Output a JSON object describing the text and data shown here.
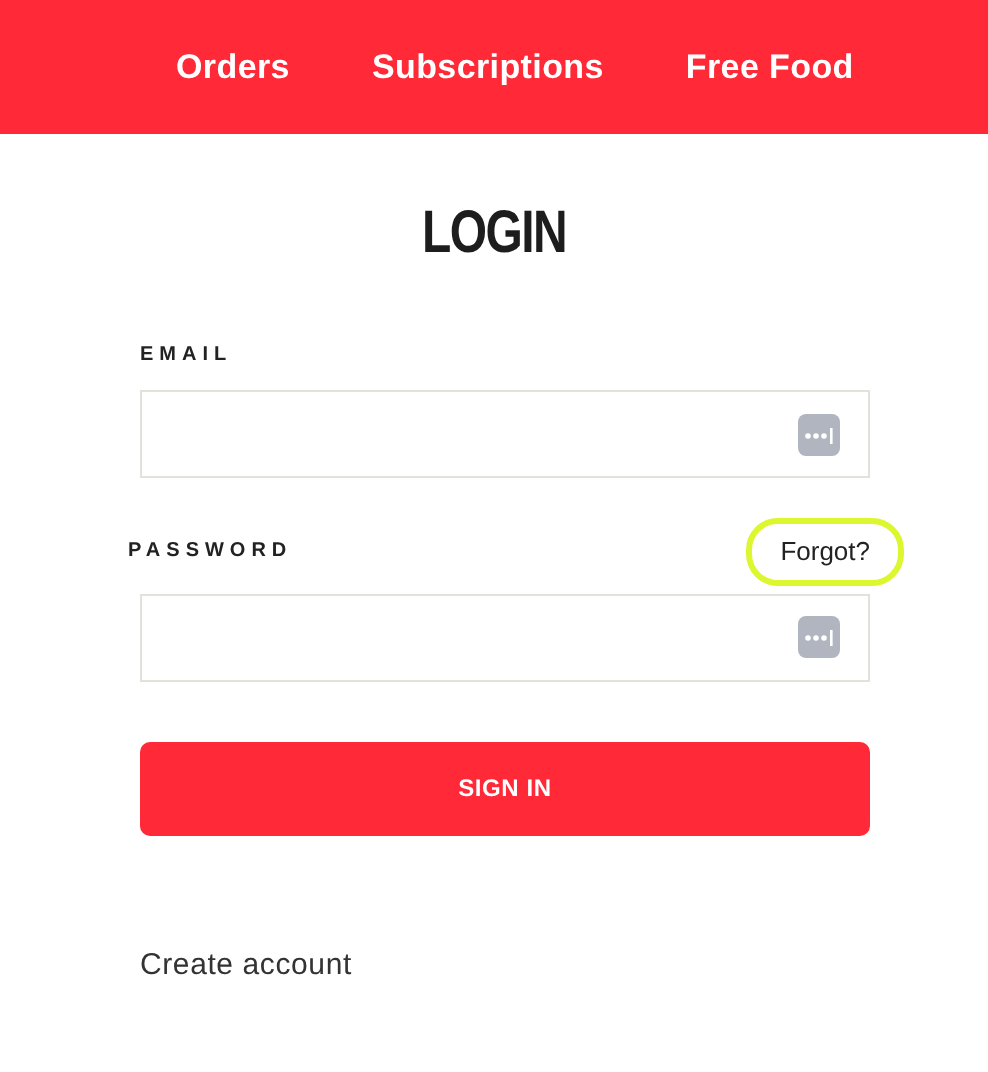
{
  "nav": [
    {
      "label": "Orders"
    },
    {
      "label": "Subscriptions"
    },
    {
      "label": "Free Food"
    }
  ],
  "title": "LOGIN",
  "fields": [
    {
      "label": "EMAIL",
      "kind": "email"
    },
    {
      "label": "PASSWORD",
      "kind": "password",
      "forgot": {
        "label": "Forgot?",
        "highlighted": true
      }
    }
  ],
  "submit": "SIGN IN",
  "create_account": "Create account"
}
